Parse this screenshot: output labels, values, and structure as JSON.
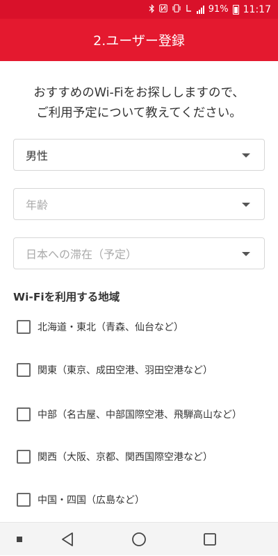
{
  "status_bar": {
    "battery": "91%",
    "time": "11:17",
    "icons": [
      "bluetooth-icon",
      "nfc-icon",
      "vibrate-icon",
      "lte-icon",
      "signal-icon",
      "battery-icon"
    ]
  },
  "header": {
    "title": "2.ユーザー登録"
  },
  "intro": "おすすめのWi-Fiをお探ししますので、\nご利用予定について教えてください。",
  "form": {
    "gender": {
      "value": "男性"
    },
    "age": {
      "placeholder": "年齢"
    },
    "stay": {
      "placeholder": "日本への滞在（予定）"
    }
  },
  "regions": {
    "title": "Wi-Fiを利用する地域",
    "items": [
      {
        "label": "北海道・東北（青森、仙台など）",
        "checked": false
      },
      {
        "label": "関東（東京、成田空港、羽田空港など）",
        "checked": false
      },
      {
        "label": "中部（名古屋、中部国際空港、飛騨高山など）",
        "checked": false
      },
      {
        "label": "関西（大阪、京都、関西国際空港など）",
        "checked": false
      },
      {
        "label": "中国・四国（広島など）",
        "checked": false
      }
    ]
  },
  "nav_bar": {
    "icons": [
      "square-dot-icon",
      "back-icon",
      "home-icon",
      "recents-icon"
    ]
  },
  "colors": {
    "brand_red": "#e4192f",
    "status_red": "#d9112a"
  }
}
